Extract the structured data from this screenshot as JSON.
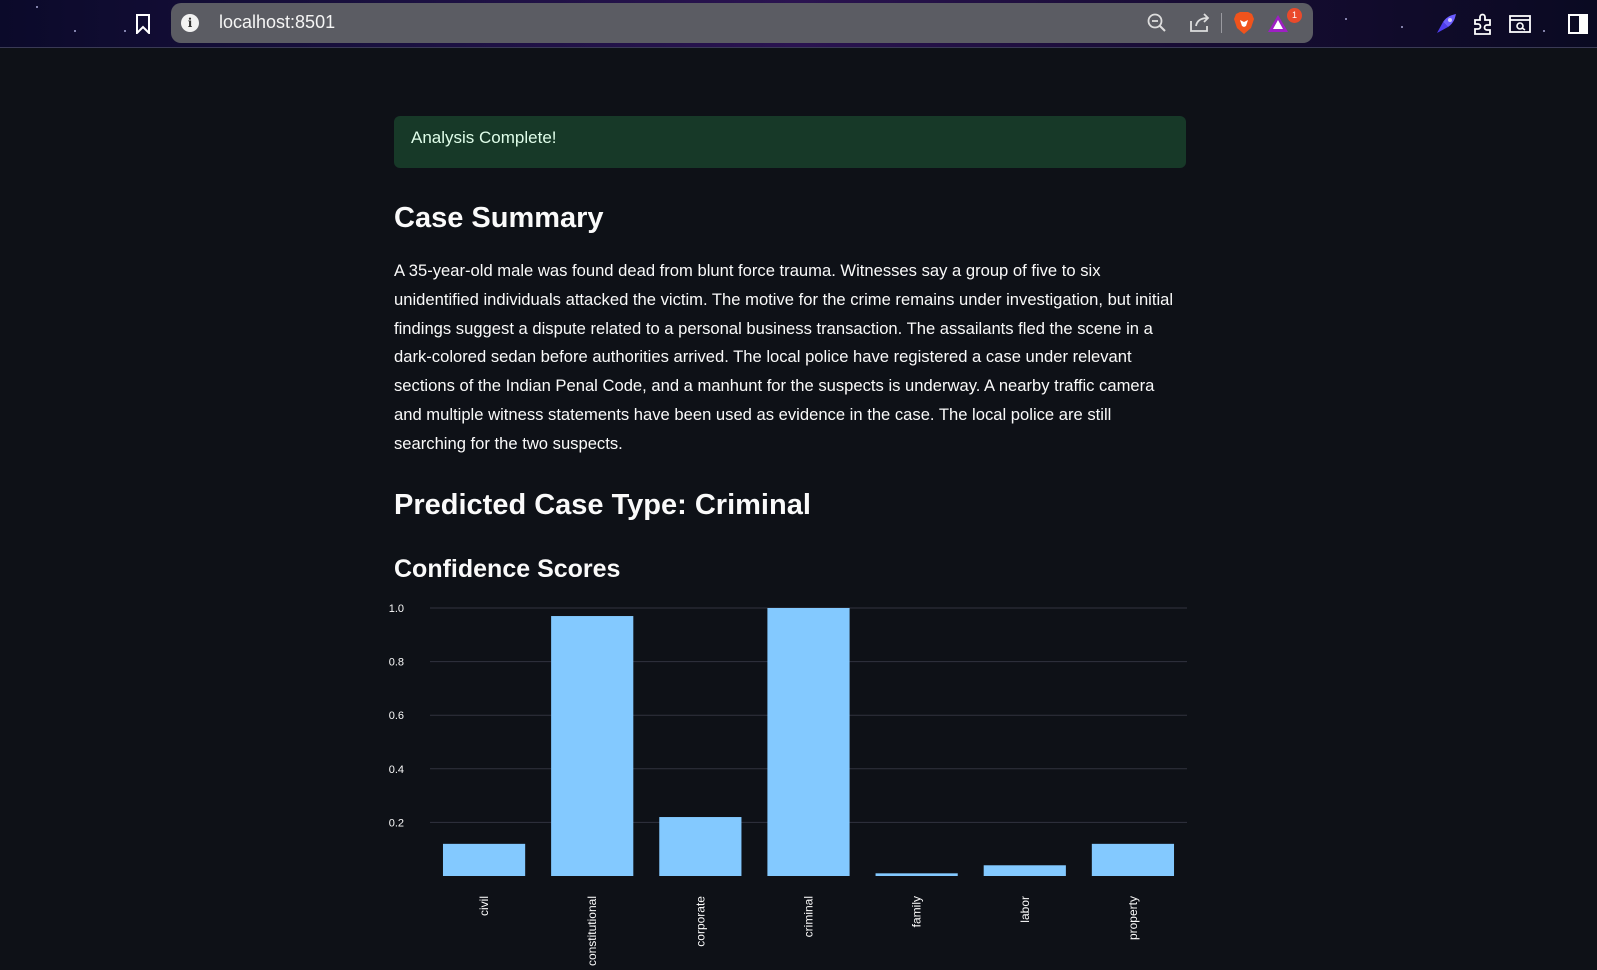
{
  "browser": {
    "url": "localhost:8501",
    "notification_count": "1"
  },
  "alert": {
    "text": "Analysis Complete!"
  },
  "summary": {
    "heading": "Case Summary",
    "text": "A 35-year-old male was found dead from blunt force trauma. Witnesses say a group of five to six unidentified individuals attacked the victim. The motive for the crime remains under investigation, but initial findings suggest a dispute related to a personal business transaction. The assailants fled the scene in a dark-colored sedan before authorities arrived. The local police have registered a case under relevant sections of the Indian Penal Code, and a manhunt for the suspects is underway. A nearby traffic camera and multiple witness statements have been used as evidence in the case. The local police are still searching for the two suspects."
  },
  "prediction": {
    "heading": "Predicted Case Type: Criminal"
  },
  "confidence": {
    "heading": "Confidence Scores"
  },
  "colors": {
    "bar": "#83c9ff",
    "grid": "#31333f",
    "background": "#0e1117",
    "alert_bg": "#173928"
  },
  "chart_data": {
    "type": "bar",
    "categories": [
      "civil",
      "constitutional",
      "corporate",
      "criminal",
      "family",
      "labor",
      "property"
    ],
    "values": [
      0.12,
      0.97,
      0.22,
      1.0,
      0.01,
      0.04,
      0.12
    ],
    "ylim": [
      0,
      1.0
    ],
    "yticks": [
      0.2,
      0.4,
      0.6,
      0.8,
      1.0
    ],
    "ytick_labels": [
      "0.2",
      "0.4",
      "0.6",
      "0.8",
      "1.0"
    ],
    "grid": true,
    "xlabel": "",
    "ylabel": ""
  }
}
